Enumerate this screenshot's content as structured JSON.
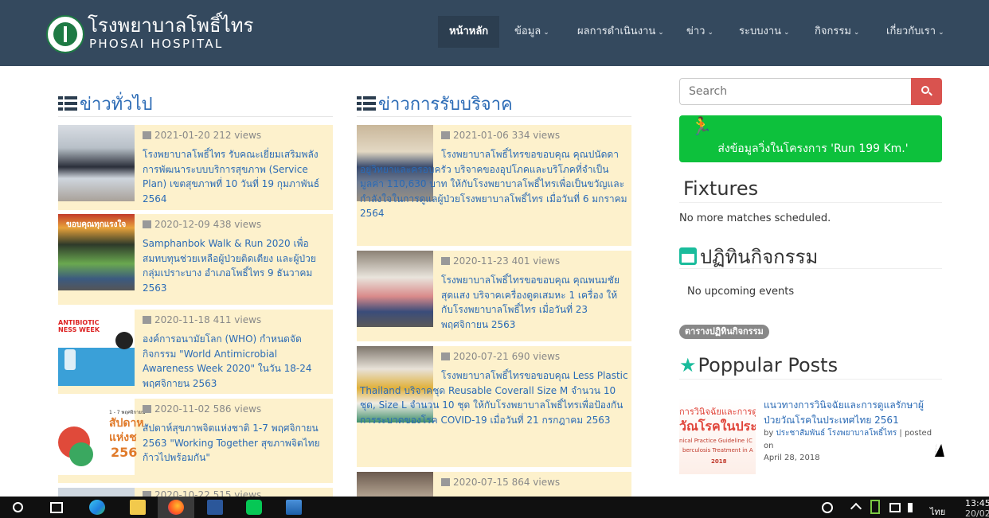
{
  "brand": {
    "name_th": "โรงพยาบาลโพธิ์ไทร",
    "name_en": "PHOSAI HOSPITAL"
  },
  "nav": [
    {
      "label": "หน้าหลัก",
      "active": true
    },
    {
      "label": "ข้อมูล",
      "dropdown": true
    },
    {
      "label": "ผลการดำเนินงาน",
      "dropdown": true
    },
    {
      "label": "ข่าว",
      "dropdown": true
    },
    {
      "label": "ระบบงาน",
      "dropdown": true
    },
    {
      "label": "กิจกรรม",
      "dropdown": true
    },
    {
      "label": "เกี่ยวกับเรา",
      "dropdown": true
    }
  ],
  "general_news": {
    "title": "ข่าวทั่วไป",
    "items": [
      {
        "date": "2021-01-20",
        "views": "212 views",
        "title": "โรงพยาบาลโพธิ์ไทร รับคณะเยี่ยมเสริมพลัง การพัฒนาระบบบริการสุขภาพ (Service Plan) เขตสุขภาพที่ 10 วันที่ 19 กุมภาพันธ์ 2564"
      },
      {
        "date": "2020-12-09",
        "views": "438 views",
        "title": "Samphanbok Walk & Run 2020 เพื่อสมทบทุนช่วยเหลือผู้ป่วยติดเตียง และผู้ป่วยกลุ่มเปราะบาง อำเภอโพธิ์ไทร 9 ธันวาคม 2563"
      },
      {
        "date": "2020-11-18",
        "views": "411 views",
        "title": "องค์การอนามัยโลก (WHO) กำหนดจัดกิจกรรม \"World Antimicrobial Awareness Week 2020\" ในวัน 18-24 พฤศจิกายน 2563"
      },
      {
        "date": "2020-11-02",
        "views": "586 views",
        "title": "สัปดาห์สุขภาพจิตแห่งชาติ 1-7 พฤศจิกายน 2563 \"Working Together สุขภาพจิตไทย ก้าวไปพร้อมกัน\""
      },
      {
        "date": "2020-10-22",
        "views": "515 views",
        "title": ""
      }
    ]
  },
  "donation_news": {
    "title": "ข่าวการรับบริจาค",
    "items": [
      {
        "date": "2021-01-06",
        "views": "334 views",
        "title": "โรงพยาบาลโพธิ์ไทรขอขอบคุณ คุณปนัดดา อยู่วิทยาและครอบครัว บริจาคของอุปโภคและบริโภคที่จำเป็นมูลค่า 110,630 บาท ให้กับโรงพยาบาลโพธิ์ไทรเพื่อเป็นขวัญและกำลังใจในการดูแลผู้ป่วยโรงพยาบาลโพธิ์ไทร เมื่อวันที่ 6 มกราคม 2564"
      },
      {
        "date": "2020-11-23",
        "views": "401 views",
        "title": "โรงพยาบาลโพธิ์ไทรขอขอบคุณ คุณพนมชัย สุดแสง บริจาคเครื่องดูดเสมหะ 1 เครื่อง ให้กับโรงพยาบาลโพธิ์ไทร เมื่อวันที่ 23 พฤศจิกายน 2563"
      },
      {
        "date": "2020-07-21",
        "views": "690 views",
        "title": "โรงพยาบาลโพธิ์ไทรขอขอบคุณ Less Plastic Thailand บริจาคชุด Reusable Coverall Size M จำนวน 10 ชุด, Size L จำนวน 10 ชุด ให้กับโรงพยาบาลโพธิ์ไทรเพื่อป้องกันการระบาดของโรค COVID-19 เมื่อวันที่ 21 กรกฎาคม 2563"
      },
      {
        "date": "2020-07-15",
        "views": "864 views",
        "title": ""
      }
    ]
  },
  "sidebar": {
    "search_placeholder": "Search",
    "run_banner": "ส่งข้อมูลวิ่งในโครงการ 'Run 199 Km.'",
    "fixtures_title": "Fixtures",
    "fixtures_text": "No more matches scheduled.",
    "calendar_title": "ปฏิทินกิจกรรม",
    "calendar_text": "No upcoming events",
    "calendar_badge": "ตารางปฏิทินกิจกรรม",
    "popular_title": "Poppular Posts",
    "popular_post": {
      "title": "แนวทางการวินิจฉัยและการดูแลรักษาผู้ป่วยวัณโรคในประเทศไทย 2561",
      "by": "by",
      "author": "ประชาสัมพันธ์ โรงพยาบาลโพธิ์ไทร",
      "posted_on": "| posted on",
      "date": "April 28, 2018",
      "thumb_line1": "การวินิจฉัยและการดูแ",
      "thumb_line2": "วัณโรคในประเท",
      "thumb_line3": "nical Practice Guideline (C",
      "thumb_line4": "berculosis Treatment in A",
      "thumb_line5": "2018"
    }
  },
  "thumb_text": {
    "antibiotic_line1": "ANTIBIOTIC",
    "antibiotic_line2": "NESS WEEK",
    "mental_line1": "1 - 7 พฤศจิกายน",
    "mental_line2": "สัปดาห",
    "mental_line3": "แห่งช",
    "mental_line4": "256",
    "walk_banner": "ขอบคุณทุกแรงใจ"
  },
  "taskbar": {
    "time": "13:45",
    "date": "20/02/2",
    "lang": "ไทย"
  },
  "colors": {
    "navbar": "#34495e",
    "accent_blue": "#2a6ab5",
    "card_bg": "#fdf1cc",
    "run_green": "#0dc13c",
    "teal": "#1abc9c",
    "search_red": "#d9534f"
  }
}
